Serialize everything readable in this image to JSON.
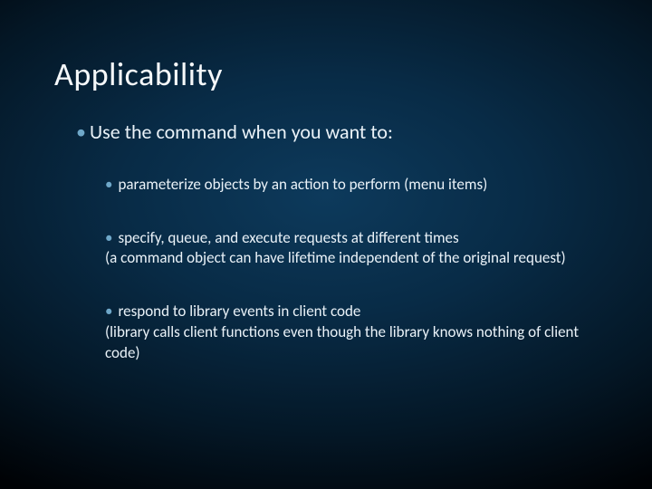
{
  "title": "Applicability",
  "level1_text": "Use the command when you want to:",
  "items": [
    "parameterize objects by an action to perform (menu items)",
    "specify, queue, and execute requests at different times\n(a command object can have lifetime independent of the original request)",
    "respond to library events in client code\n(library calls client functions even though the library knows nothing of client code)"
  ]
}
